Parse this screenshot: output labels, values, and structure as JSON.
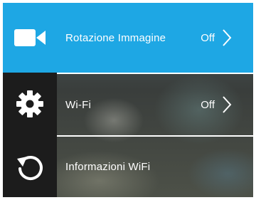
{
  "sidebar": {
    "items": [
      {
        "icon": "video-camera-icon",
        "active": true
      },
      {
        "icon": "gear-icon",
        "active": false
      },
      {
        "icon": "back-arrow-icon",
        "active": false
      }
    ]
  },
  "menu": {
    "items": [
      {
        "label": "Rotazione Immagine",
        "value": "Off",
        "selected": true
      },
      {
        "label": "Wi-Fi",
        "value": "Off",
        "selected": false
      },
      {
        "label": "Informazioni WiFi",
        "value": "",
        "selected": false
      }
    ]
  },
  "colors": {
    "accent": "#1ea7e4",
    "sidebar_bg": "#1c1c1c",
    "text": "#ffffff"
  }
}
